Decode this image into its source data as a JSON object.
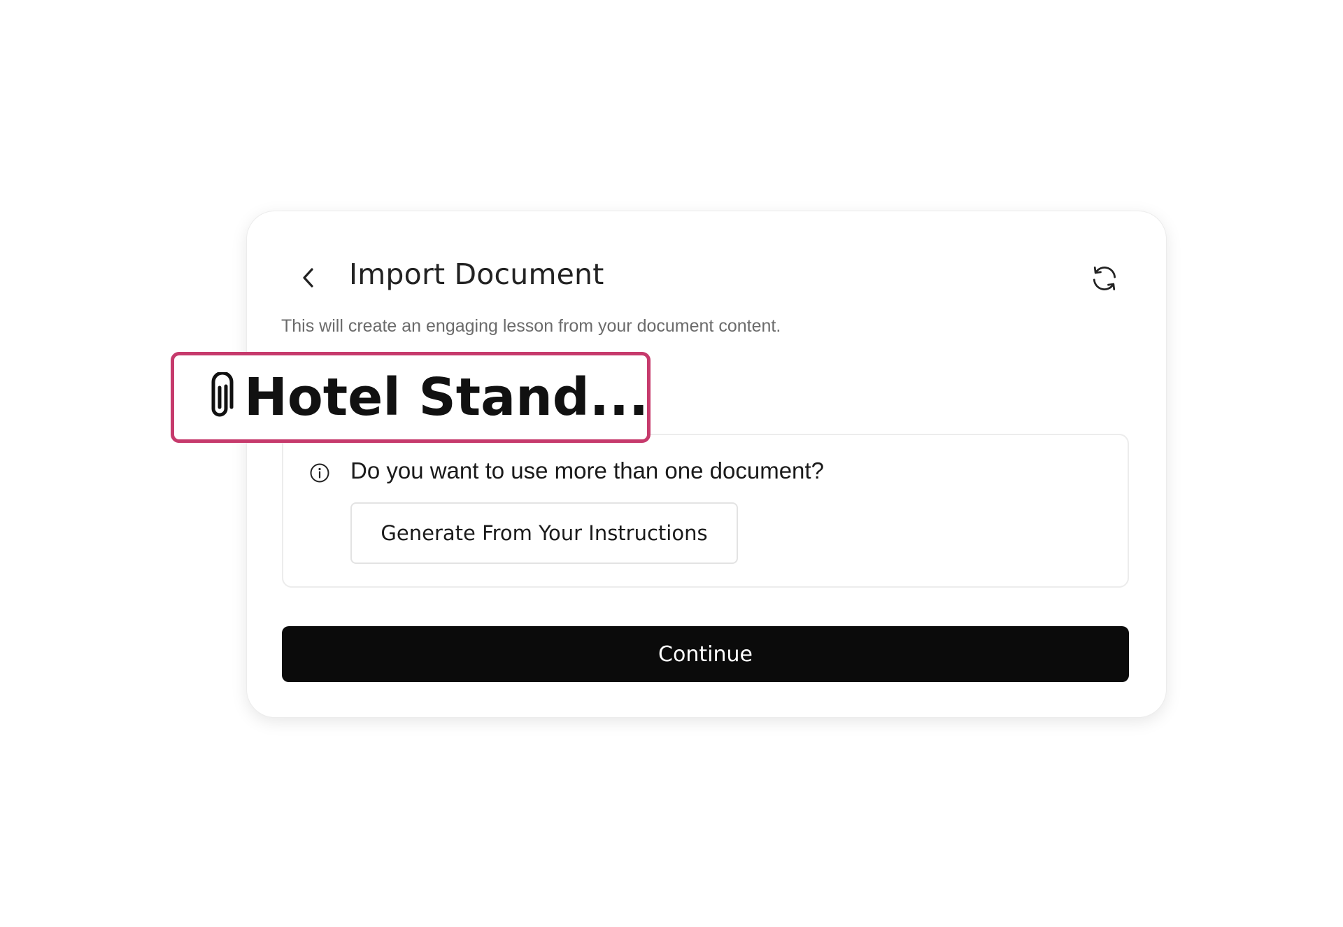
{
  "dialog": {
    "title": "Import Document",
    "subtitle": "This will create an engaging lesson from your document content.",
    "icons": {
      "back": "chevron-left-icon",
      "refresh": "refresh-icon"
    }
  },
  "attachment": {
    "name": "Hotel Stand...",
    "icon": "paperclip-icon",
    "highlight_color": "#c63a6c"
  },
  "info": {
    "icon": "info-icon",
    "question": "Do you want to use more than one document?",
    "button_label": "Generate From Your Instructions"
  },
  "actions": {
    "continue_label": "Continue",
    "continue_color": "#0b0b0b"
  }
}
